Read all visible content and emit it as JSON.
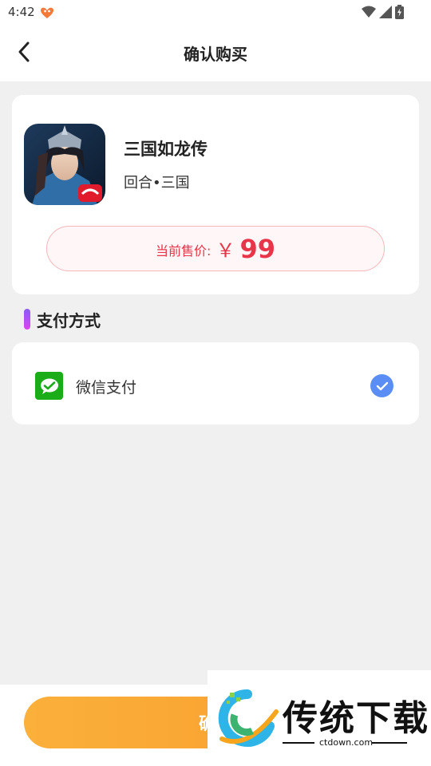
{
  "status_bar": {
    "time": "4:42",
    "icons": [
      "app-notification-icon",
      "wifi-icon",
      "signal-icon",
      "battery-charging-icon"
    ]
  },
  "header": {
    "title": "确认购买",
    "back_icon": "chevron-left-icon"
  },
  "product": {
    "name": "三国如龙传",
    "tags": "回合•三国",
    "price_label": "当前售价:",
    "currency_symbol": "￥",
    "price": "99"
  },
  "payment": {
    "section_title": "支付方式",
    "methods": [
      {
        "label": "微信支付",
        "icon": "wechat-pay-icon",
        "selected": true
      }
    ]
  },
  "bottom": {
    "confirm_label": "确认"
  },
  "watermark": {
    "title": "传统下载",
    "domain": "ctdown.com"
  },
  "colors": {
    "price_red": "#e8354a",
    "accent_orange": "#f89b2c",
    "check_blue": "#5b8ef5",
    "wechat_green": "#1aad19",
    "section_accent": "#8b5cf6"
  }
}
